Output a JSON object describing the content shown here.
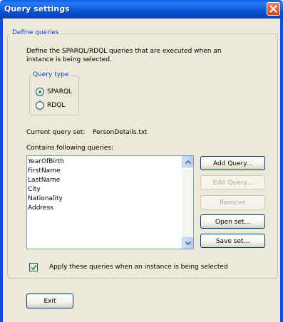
{
  "window": {
    "title": "Query settings"
  },
  "define_group": {
    "legend": "Define queries",
    "description_line1": "Define the SPARQL/RDQL queries that are executed when an",
    "description_line2": "instance is being selected."
  },
  "query_type": {
    "legend": "Query type",
    "options": [
      {
        "label": "SPARQL",
        "selected": true
      },
      {
        "label": "RDQL",
        "selected": false
      }
    ]
  },
  "current_set": {
    "label": "Current query set:",
    "value": "PersonDetails.txt"
  },
  "queries": {
    "label": "Contains following queries:",
    "items": [
      "YearOfBirth",
      "FirstName",
      "LastName",
      "City",
      "Nationality",
      "Address"
    ]
  },
  "buttons": {
    "add_query": "Add Query...",
    "edit_query": "Edit Query...",
    "remove": "Remove",
    "open_set": "Open set...",
    "save_set": "Save set...",
    "exit": "Exit"
  },
  "apply_checkbox": {
    "label": "Apply these queries when an instance is being selected",
    "checked": true
  },
  "icons": {
    "close": "close-icon",
    "scroll_up": "scroll-up-icon",
    "scroll_down": "scroll-down-icon",
    "check": "checkmark-icon"
  },
  "colors": {
    "titlebar": "#0a58d6",
    "legend_text": "#0046d5",
    "close_button": "#d3471f",
    "dialog_bg": "#ece9d8",
    "radio_dot": "#21a121"
  }
}
